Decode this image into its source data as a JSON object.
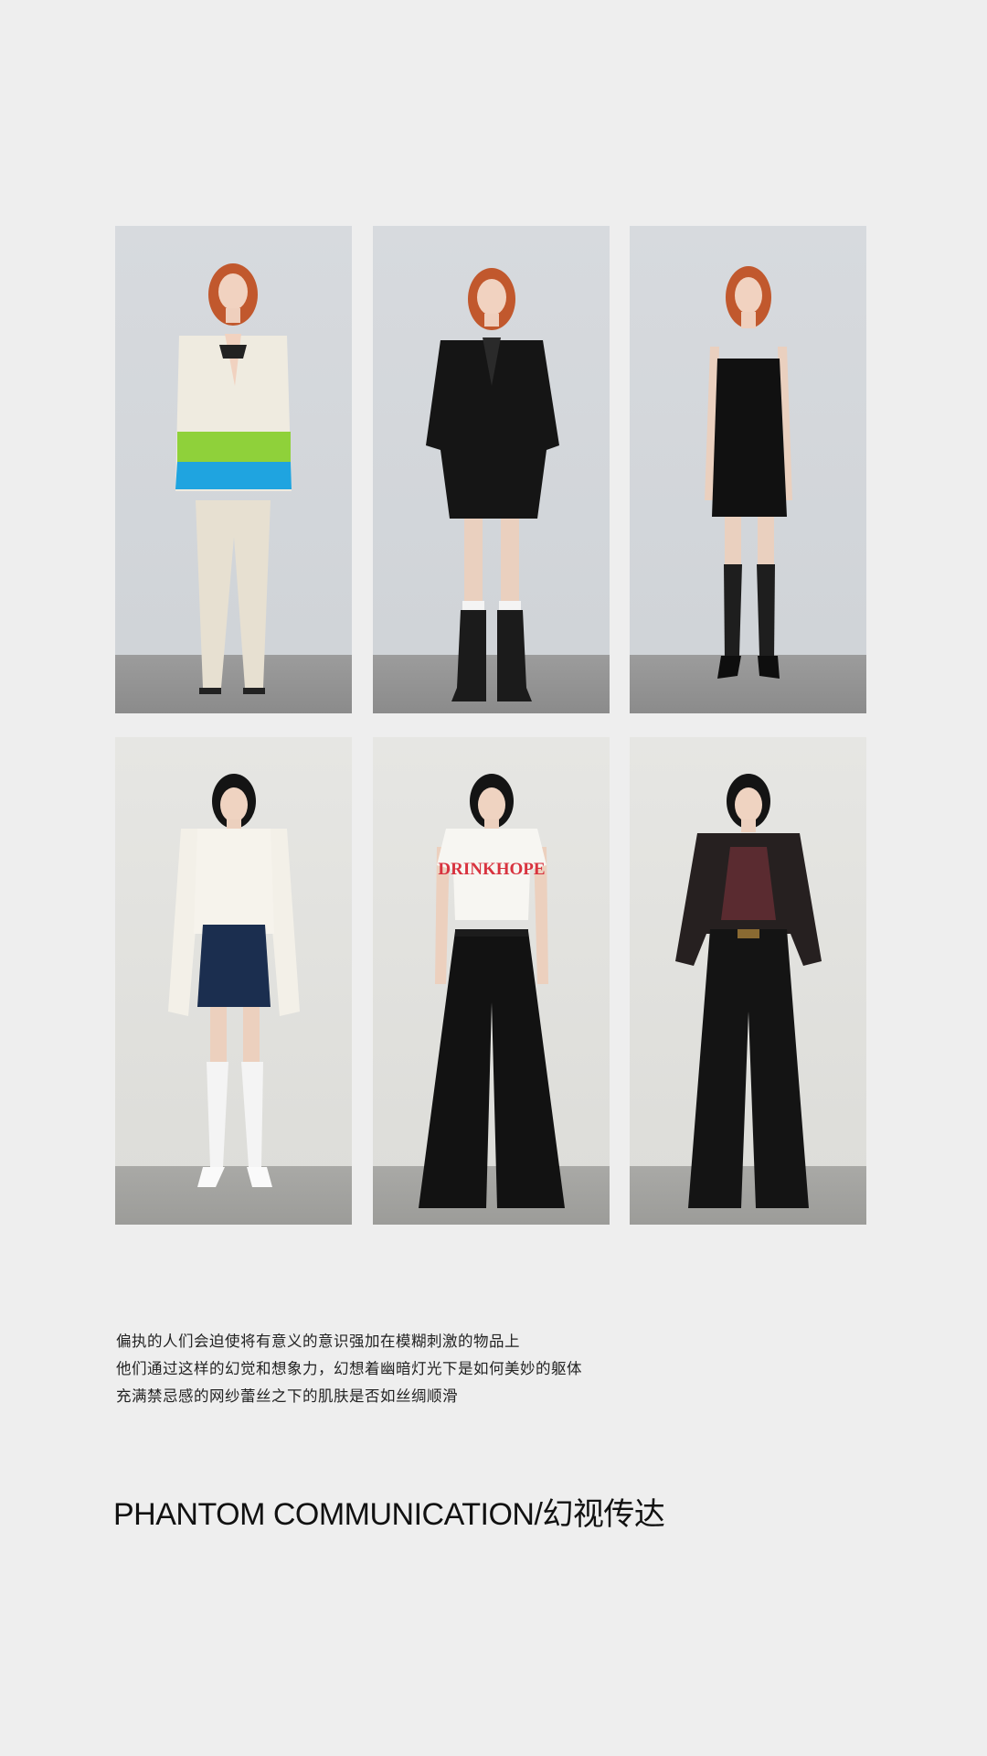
{
  "gallery": {
    "tiles": [
      {
        "name": "look-1-color-block-blazer",
        "outfit": "cream blazer with green-blue dip-dye hem and wide cream trousers"
      },
      {
        "name": "look-2-black-sheer-blazer",
        "outfit": "black sheer blazer with shorts and black rain boots"
      },
      {
        "name": "look-3-black-slip-dress",
        "outfit": "black slip dress with sheer knee socks and heels"
      },
      {
        "name": "look-4-white-shirt-denim-skirt",
        "outfit": "oversized white shirt with denim mini skirt and white socks"
      },
      {
        "name": "look-5-tee-wide-jeans",
        "outfit": "white graphic tee with black wide-leg jeans"
      },
      {
        "name": "look-6-cropped-blazer-flares",
        "outfit": "cropped dark blazer with black flared jeans"
      }
    ],
    "tee_print": "DRINKHOPE"
  },
  "caption": {
    "line1": "偏执的人们会迫使将有意义的意识强加在模糊刺激的物品上",
    "line2": "他们通过这样的幻觉和想象力，幻想着幽暗灯光下是如何美妙的躯体",
    "line3": "充满禁忌感的网纱蕾丝之下的肌肤是否如丝绸顺滑"
  },
  "title": "PHANTOM COMMUNICATION/幻视传达",
  "colors": {
    "background": "#eeeeee",
    "green": "#8fd13a",
    "blue": "#1fa4e0",
    "tee_red": "#d8333f"
  }
}
